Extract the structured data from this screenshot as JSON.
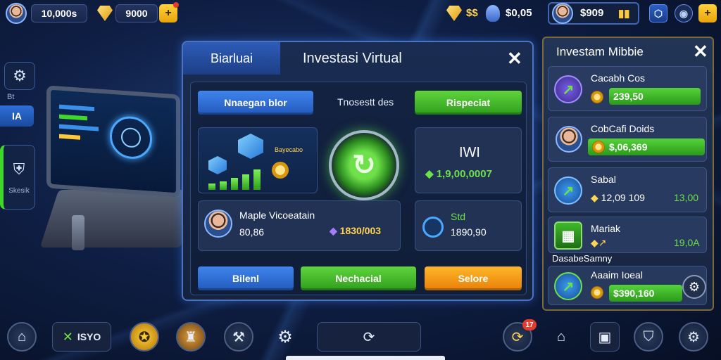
{
  "topbar": {
    "coins_left": "10,000s",
    "gems": "9000",
    "plus_label": "+",
    "currency_symbol": "$$",
    "balance_center": "$0,05",
    "balance_right": "$909",
    "bars_label": "▮▮"
  },
  "left": {
    "nav_label": "IA",
    "settings_label": "Bt",
    "stats_label": "Skesik"
  },
  "modal": {
    "tab_label": "Biarluai",
    "title": "Investasi Virtual",
    "close_label": "✕",
    "btn_top_left": "Nnaegan blor",
    "top_center": "Tnosestt des",
    "btn_top_right": "Rispeciat",
    "chart_label": "Bayecabo",
    "chart_bars": [
      0.25,
      0.35,
      0.5,
      0.65,
      0.85
    ],
    "value_title": "IWI",
    "value_amount": "1,9,00,0007",
    "player_name": "Maple Vicoeatain",
    "player_value": "80,86",
    "player_amount": "1830/003",
    "small_label": "Std",
    "small_value": "1890,90",
    "btn_bottom_left": "Bilenl",
    "btn_bottom_mid": "Nechacial",
    "btn_bottom_right": "Selore",
    "accent_blue": "#2f6fd8",
    "accent_green": "#43b52a",
    "accent_orange": "#f59a14"
  },
  "rpanel": {
    "title": "Investam Mibbie",
    "close_label": "✕",
    "items": [
      {
        "name": "Cacabh Cos",
        "value": "239,50",
        "bar_fill": 0.6
      },
      {
        "name": "CobCafi Doids",
        "value": "$,06,369",
        "bar_fill": 1.0
      },
      {
        "name": "Sabal",
        "value": "12,09 109",
        "extra": "13,00"
      },
      {
        "name": "Mariak",
        "value": "19,0A"
      },
      {
        "name": "Aaaim Ioeal",
        "value": "$390,160",
        "bar_fill": 0.8
      }
    ],
    "section_label": "DasabeSamny"
  },
  "bottombar": {
    "tools_label": "ISYO",
    "badge_count": "17"
  }
}
